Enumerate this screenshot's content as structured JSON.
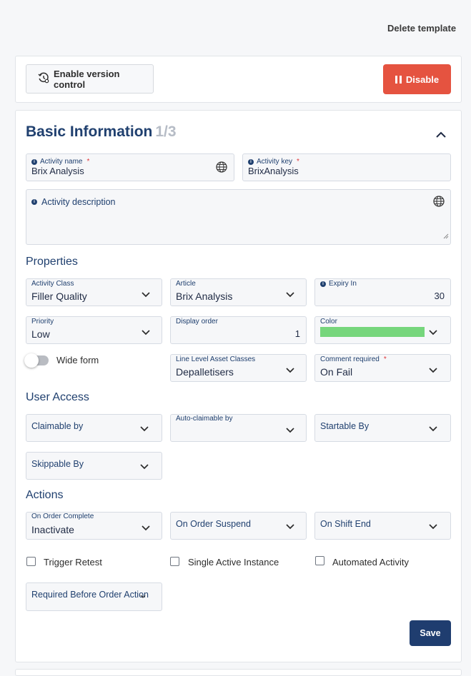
{
  "header": {
    "delete_template_label": "Delete template"
  },
  "toolbar": {
    "version_control_label": "Enable version control",
    "disable_label": "Disable"
  },
  "basic_info": {
    "title": "Basic Information",
    "step": "1/3",
    "activity_name": {
      "label": "Activity name",
      "value": "Brix Analysis"
    },
    "activity_key": {
      "label": "Activity key",
      "value": "BrixAnalysis"
    },
    "activity_description": {
      "label": "Activity description"
    }
  },
  "properties": {
    "title": "Properties",
    "activity_class": {
      "label": "Activity Class",
      "value": "Filler Quality"
    },
    "article": {
      "label": "Article",
      "value": "Brix Analysis"
    },
    "expiry_in": {
      "label": "Expiry In",
      "value": "30"
    },
    "priority": {
      "label": "Priority",
      "value": "Low"
    },
    "display_order": {
      "label": "Display order",
      "value": "1"
    },
    "color": {
      "label": "Color",
      "value": "#76d67c"
    },
    "wide_form": {
      "label": "Wide form"
    },
    "line_level_asset_classes": {
      "label": "Line Level Asset Classes",
      "value": "Depalletisers"
    },
    "comment_required": {
      "label": "Comment required",
      "value": "On Fail"
    }
  },
  "user_access": {
    "title": "User Access",
    "claimable_by": "Claimable by",
    "auto_claimable_by": "Auto-claimable by",
    "startable_by": "Startable By",
    "skippable_by": "Skippable By"
  },
  "actions": {
    "title": "Actions",
    "on_order_complete": {
      "label": "On Order Complete",
      "value": "Inactivate"
    },
    "on_order_suspend": "On Order Suspend",
    "on_shift_end": "On Shift End",
    "trigger_retest": "Trigger Retest",
    "single_active_instance": "Single Active Instance",
    "automated_activity": "Automated Activity",
    "required_before_order_action": "Required Before Order Action"
  },
  "footer": {
    "save_label": "Save"
  }
}
